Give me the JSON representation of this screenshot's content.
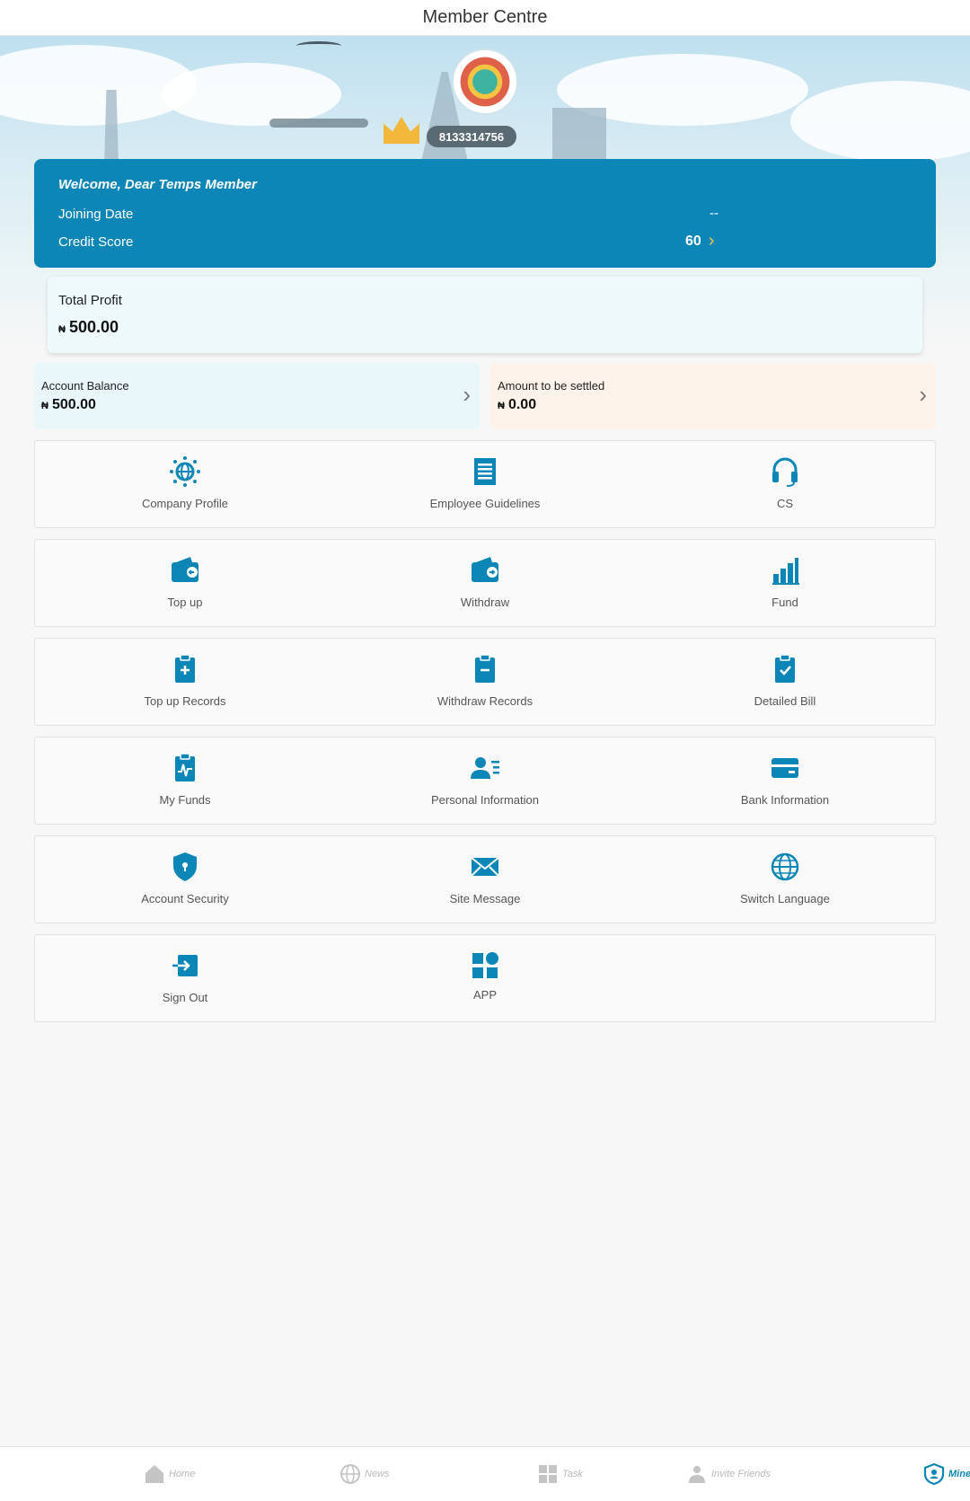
{
  "header": {
    "title": "Member Centre"
  },
  "profile": {
    "user_id": "8133314756"
  },
  "welcome": {
    "title": "Welcome, Dear Temps Member",
    "joining_date_label": "Joining Date",
    "joining_date_value": "--",
    "credit_score_label": "Credit Score",
    "credit_score_value": "60"
  },
  "profit": {
    "label": "Total Profit",
    "currency": "₦",
    "value": "500.00"
  },
  "balances": {
    "account_balance_label": "Account Balance",
    "account_balance_value": "500.00",
    "settle_label": "Amount to be settled",
    "settle_value": "0.00",
    "currency": "₦"
  },
  "menu": {
    "company_profile": "Company Profile",
    "employee_guidelines": "Employee Guidelines",
    "cs": "CS",
    "top_up": "Top up",
    "withdraw": "Withdraw",
    "fund": "Fund",
    "top_up_records": "Top up Records",
    "withdraw_records": "Withdraw Records",
    "detailed_bill": "Detailed Bill",
    "my_funds": "My Funds",
    "personal_information": "Personal Information",
    "bank_information": "Bank Information",
    "account_security": "Account Security",
    "site_message": "Site Message",
    "switch_language": "Switch Language",
    "sign_out": "Sign Out",
    "app": "APP"
  },
  "nav": {
    "home": "Home",
    "news": "News",
    "task": "Task",
    "invite": "Invite Friends",
    "mine": "Mine"
  },
  "colors": {
    "accent": "#0c86b6",
    "score_chevron": "#f3c640",
    "settle_bg": "#fdf3ea",
    "balance_bg": "#e9f7fb"
  }
}
